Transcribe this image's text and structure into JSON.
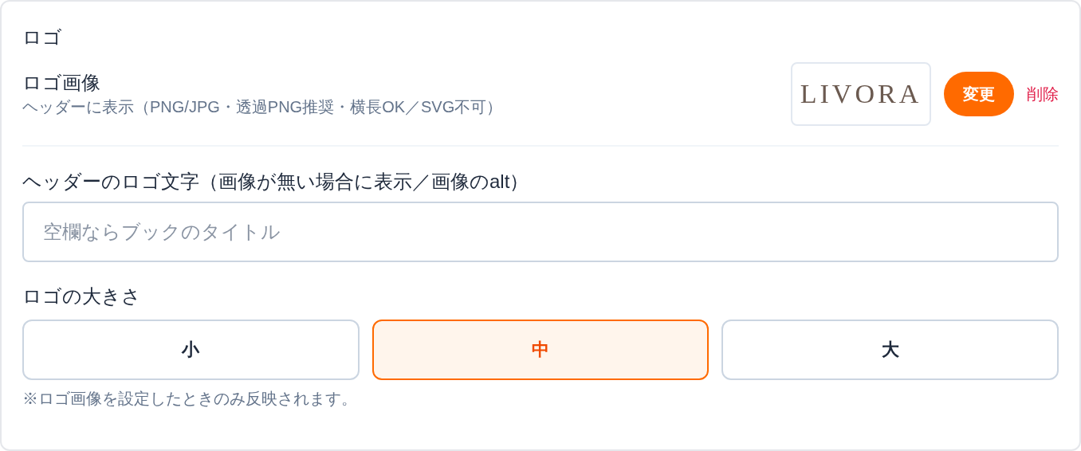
{
  "section_title": "ロゴ",
  "logo_image": {
    "label": "ロゴ画像",
    "hint": "ヘッダーに表示（PNG/JPG・透過PNG推奨・横長OK／SVG不可）",
    "preview_text": "LIVORA",
    "change_button": "変更",
    "delete_link": "削除"
  },
  "logo_text": {
    "label": "ヘッダーのロゴ文字（画像が無い場合に表示／画像のalt）",
    "placeholder": "空欄ならブックのタイトル"
  },
  "logo_size": {
    "label": "ロゴの大きさ",
    "options": [
      {
        "label": "小",
        "selected": false
      },
      {
        "label": "中",
        "selected": true
      },
      {
        "label": "大",
        "selected": false
      }
    ],
    "note": "※ロゴ画像を設定したときのみ反映されます。"
  }
}
